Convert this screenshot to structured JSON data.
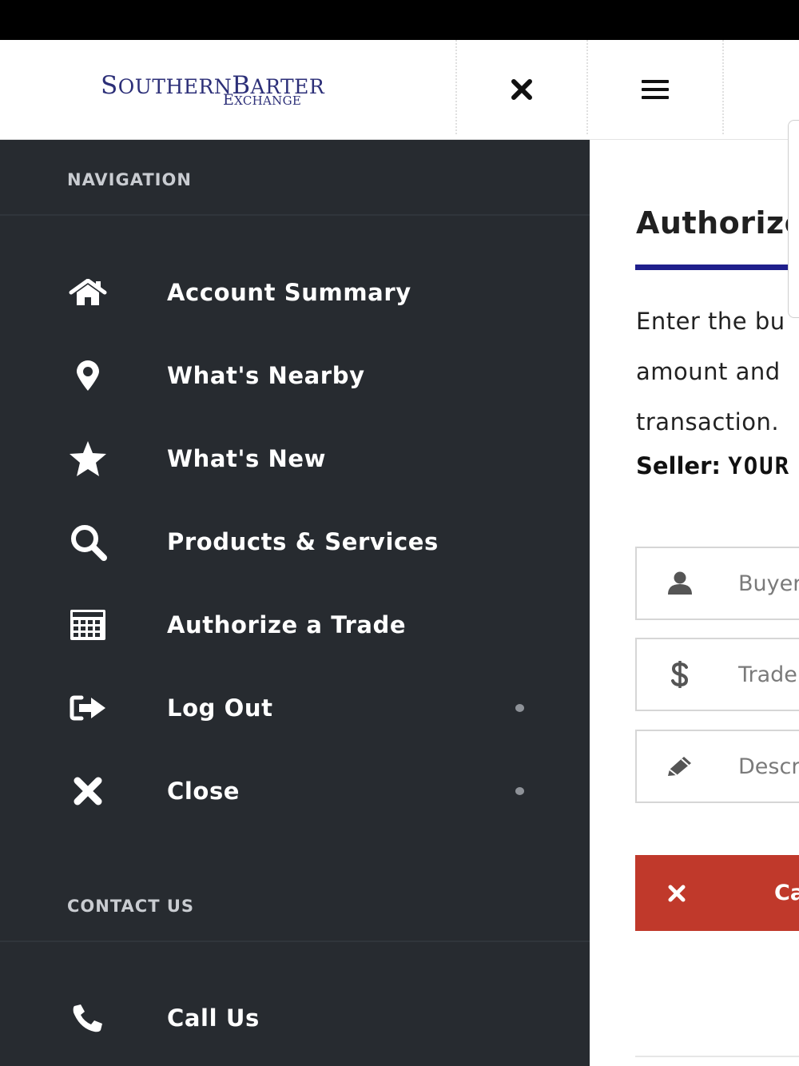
{
  "header": {
    "logo": {
      "line1_cap1": "S",
      "line1_rest1": "OUTHERN",
      "line1_cap2": "B",
      "line1_rest2": "ARTER",
      "line2_cap": "E",
      "line2_rest": "XCHANGE"
    },
    "close_icon": "close-icon",
    "menu_icon": "hamburger-menu-icon"
  },
  "drawer": {
    "navigation_heading": "NAVIGATION",
    "items": [
      {
        "label": "Account Summary",
        "icon": "home-icon"
      },
      {
        "label": "What's Nearby",
        "icon": "map-pin-icon"
      },
      {
        "label": "What's New",
        "icon": "star-icon"
      },
      {
        "label": "Products & Services",
        "icon": "search-icon"
      },
      {
        "label": "Authorize a Trade",
        "icon": "calculator-icon"
      },
      {
        "label": "Log Out",
        "icon": "logout-icon"
      },
      {
        "label": "Close",
        "icon": "close-icon"
      }
    ],
    "contact_heading": "CONTACT US",
    "contact_items": [
      {
        "label": "Call Us",
        "icon": "phone-icon"
      }
    ]
  },
  "content": {
    "title": "Authorize",
    "description_lines": [
      "Enter the bu",
      "amount and",
      "transaction."
    ],
    "seller_label": "Seller:",
    "seller_value": "YOUR",
    "fields": [
      {
        "placeholder": "Buyer",
        "icon": "user-icon"
      },
      {
        "placeholder": "Trade",
        "icon": "dollar-icon"
      },
      {
        "placeholder": "Description",
        "icon": "pencil-icon"
      }
    ],
    "cancel_label": "Ca",
    "accent_color": "#1f1f8c",
    "cancel_color": "#c0392b"
  }
}
